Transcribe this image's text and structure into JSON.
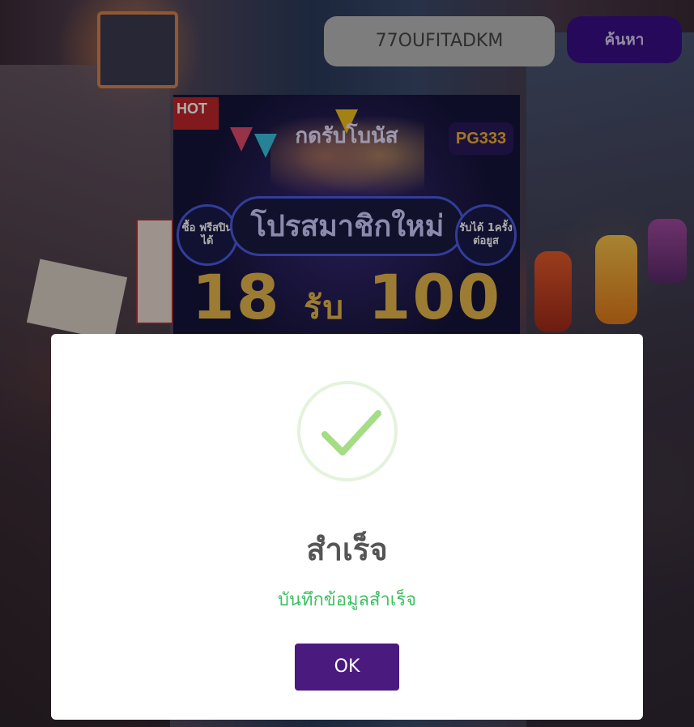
{
  "header": {
    "search_value": "77OUFITADKM",
    "search_button_label": "ค้นหา"
  },
  "banner": {
    "hot_label": "HOT",
    "claim_label": "กดรับโบนัส",
    "logo_text": "PG333",
    "promo_title": "โปรสมาชิกใหม่",
    "left_badge": "ซื้อ ฟรีสปินได้",
    "right_badge": "รับได้ 1ครั้ง ต่อยูส",
    "deposit_amount": "18",
    "get_word": "รับ",
    "bonus_amount": "100"
  },
  "modal": {
    "icon": "check-icon",
    "title": "สำเร็จ",
    "message": "บันทึกข้อมูลสำเร็จ",
    "ok_label": "OK"
  },
  "colors": {
    "button_purple": "#4a1a7e",
    "search_button": "#3a0e86",
    "success_green": "#3fbf62",
    "check_green": "#a5dc86"
  }
}
